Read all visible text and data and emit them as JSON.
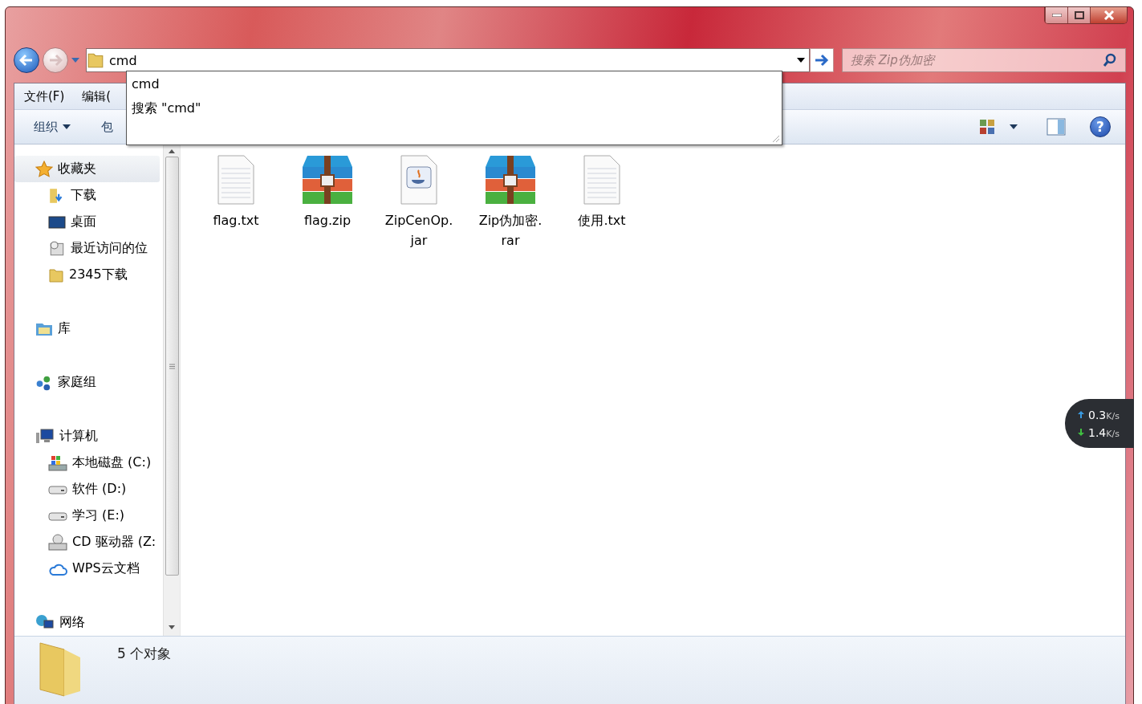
{
  "navigation": {
    "address": "cmd",
    "search": {
      "placeholder": "搜索 Zip伪加密"
    }
  },
  "autocomplete": {
    "items": [
      {
        "text": "cmd"
      },
      {
        "text": "搜索 \"cmd\""
      }
    ]
  },
  "menu_bar": [
    "文件(F)",
    "编辑("
  ],
  "toolbar": {
    "items": [
      {
        "label": "组织",
        "dropdown": true
      },
      {
        "label": "包",
        "dropdown": false
      }
    ],
    "help": "?"
  },
  "sidebar": {
    "groups": [
      {
        "label": "收藏夹",
        "kind": "favorites",
        "selected": true,
        "children": [
          {
            "label": "下载",
            "kind": "downloads"
          },
          {
            "label": "桌面",
            "kind": "desktop"
          },
          {
            "label": "最近访问的位",
            "kind": "recent"
          },
          {
            "label": "2345下载",
            "kind": "folder"
          }
        ]
      },
      {
        "label": "库",
        "kind": "library",
        "selected": false
      },
      {
        "label": "家庭组",
        "kind": "homegroup",
        "selected": false
      },
      {
        "label": "计算机",
        "kind": "computer",
        "selected": false,
        "children": [
          {
            "label": "本地磁盘 (C:)",
            "kind": "system-drive"
          },
          {
            "label": "软件 (D:)",
            "kind": "drive"
          },
          {
            "label": "学习 (E:)",
            "kind": "drive"
          },
          {
            "label": "CD 驱动器 (Z:",
            "kind": "cd"
          },
          {
            "label": "WPS云文档",
            "kind": "cloud"
          }
        ]
      },
      {
        "label": "网络",
        "kind": "network",
        "selected": false
      }
    ]
  },
  "files": [
    {
      "kind": "txt",
      "lines": [
        "flag.txt"
      ]
    },
    {
      "kind": "archive",
      "lines": [
        "flag.zip"
      ]
    },
    {
      "kind": "jar",
      "lines": [
        "ZipCenOp.",
        "jar"
      ]
    },
    {
      "kind": "archive",
      "lines": [
        "Zip伪加密.",
        "rar"
      ]
    },
    {
      "kind": "txt",
      "lines": [
        "使用.txt"
      ]
    }
  ],
  "status_bar": {
    "count": "5 个对象"
  },
  "speed_widget": {
    "upload": {
      "value": "0.3",
      "unit": "K/s"
    },
    "download": {
      "value": "1.4",
      "unit": "K/s"
    }
  }
}
